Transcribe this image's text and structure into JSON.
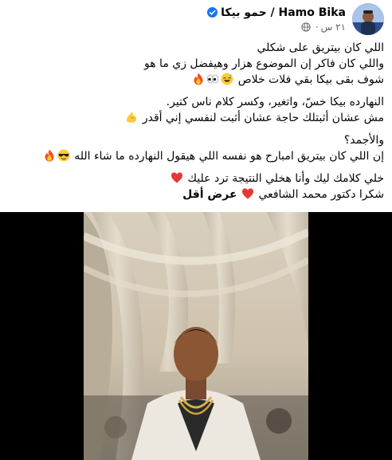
{
  "post": {
    "author_name": "حمو بيكا / Hamo Bika",
    "time": "٢١ س",
    "privacy_icon": "globe-icon",
    "verified_icon": "verified-badge-icon",
    "paragraphs": [
      [
        {
          "text": "اللي كان بيتريق على شكلي"
        },
        {
          "text": "واللي كان فاكر إن الموضوع هزار وهيفضل زي ما هو"
        },
        {
          "text": "شوف بقى بيكا بقي فلات خلاص",
          "emoji": [
            "grinning-sweat-emoji",
            "eyes-emoji",
            "fire-emoji"
          ]
        }
      ],
      [
        {
          "text": "النهارده بيكا خسّ، واتغير، وكسر كلام ناس كتير."
        },
        {
          "text": "مش عشان أثبتلك حاجة عشان أثبت لنفسي إني أقدر",
          "emoji": [
            "flexed-biceps-emoji"
          ]
        }
      ],
      [
        {
          "text": "والأجمد؟"
        },
        {
          "text": "إن اللي كان بيتريق امبارح هو نفسه اللي هيقول النهارده ما شاء الله",
          "emoji": [
            "sunglasses-emoji",
            "fire-emoji"
          ]
        }
      ],
      [
        {
          "text": "خلي كلامك ليك وأنا هخلي النتيجة ترد عليك",
          "emoji": [
            "red-heart-emoji"
          ]
        },
        {
          "text": "شكرا دكتور محمد الشافعي",
          "emoji": [
            "red-heart-emoji"
          ],
          "link": "عرض أقل"
        }
      ]
    ]
  },
  "colors": {
    "background": "#ffffff",
    "text": "#050505",
    "secondary_text": "#65676b",
    "verified_blue": "#1877f2",
    "media_background": "#000000"
  }
}
